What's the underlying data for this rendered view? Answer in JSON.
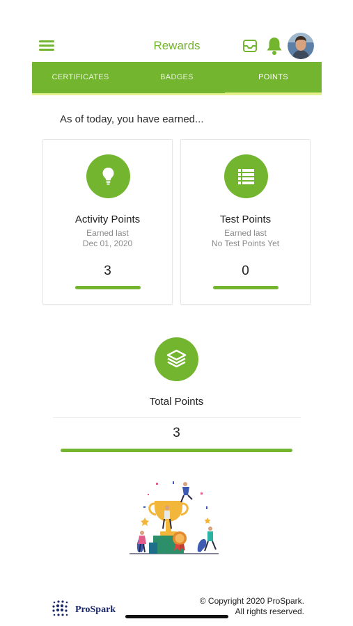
{
  "header": {
    "title": "Rewards",
    "menu_icon": "hamburger-menu-icon",
    "inbox_icon": "inbox-icon",
    "bell_icon": "bell-icon",
    "avatar": "user-avatar"
  },
  "tabs": [
    {
      "label": "CERTIFICATES",
      "active": false
    },
    {
      "label": "BADGES",
      "active": false
    },
    {
      "label": "POINTS",
      "active": true
    }
  ],
  "intro": "As of today, you have earned...",
  "cards": [
    {
      "icon": "lightbulb-icon",
      "title": "Activity Points",
      "sub1": "Earned last",
      "sub2": "Dec 01, 2020",
      "value": "3"
    },
    {
      "icon": "list-icon",
      "title": "Test Points",
      "sub1": "Earned last",
      "sub2": "No Test Points Yet",
      "value": "0"
    }
  ],
  "total": {
    "icon": "layers-icon",
    "label": "Total Points",
    "value": "3"
  },
  "footer": {
    "brand": "ProSpark",
    "copyright_line1": "© Copyright 2020 ProSpark.",
    "copyright_line2": "All rights reserved."
  },
  "colors": {
    "accent": "#73b52f",
    "tab_indicator": "#e4f08a",
    "brand_navy": "#1c2a6b"
  }
}
